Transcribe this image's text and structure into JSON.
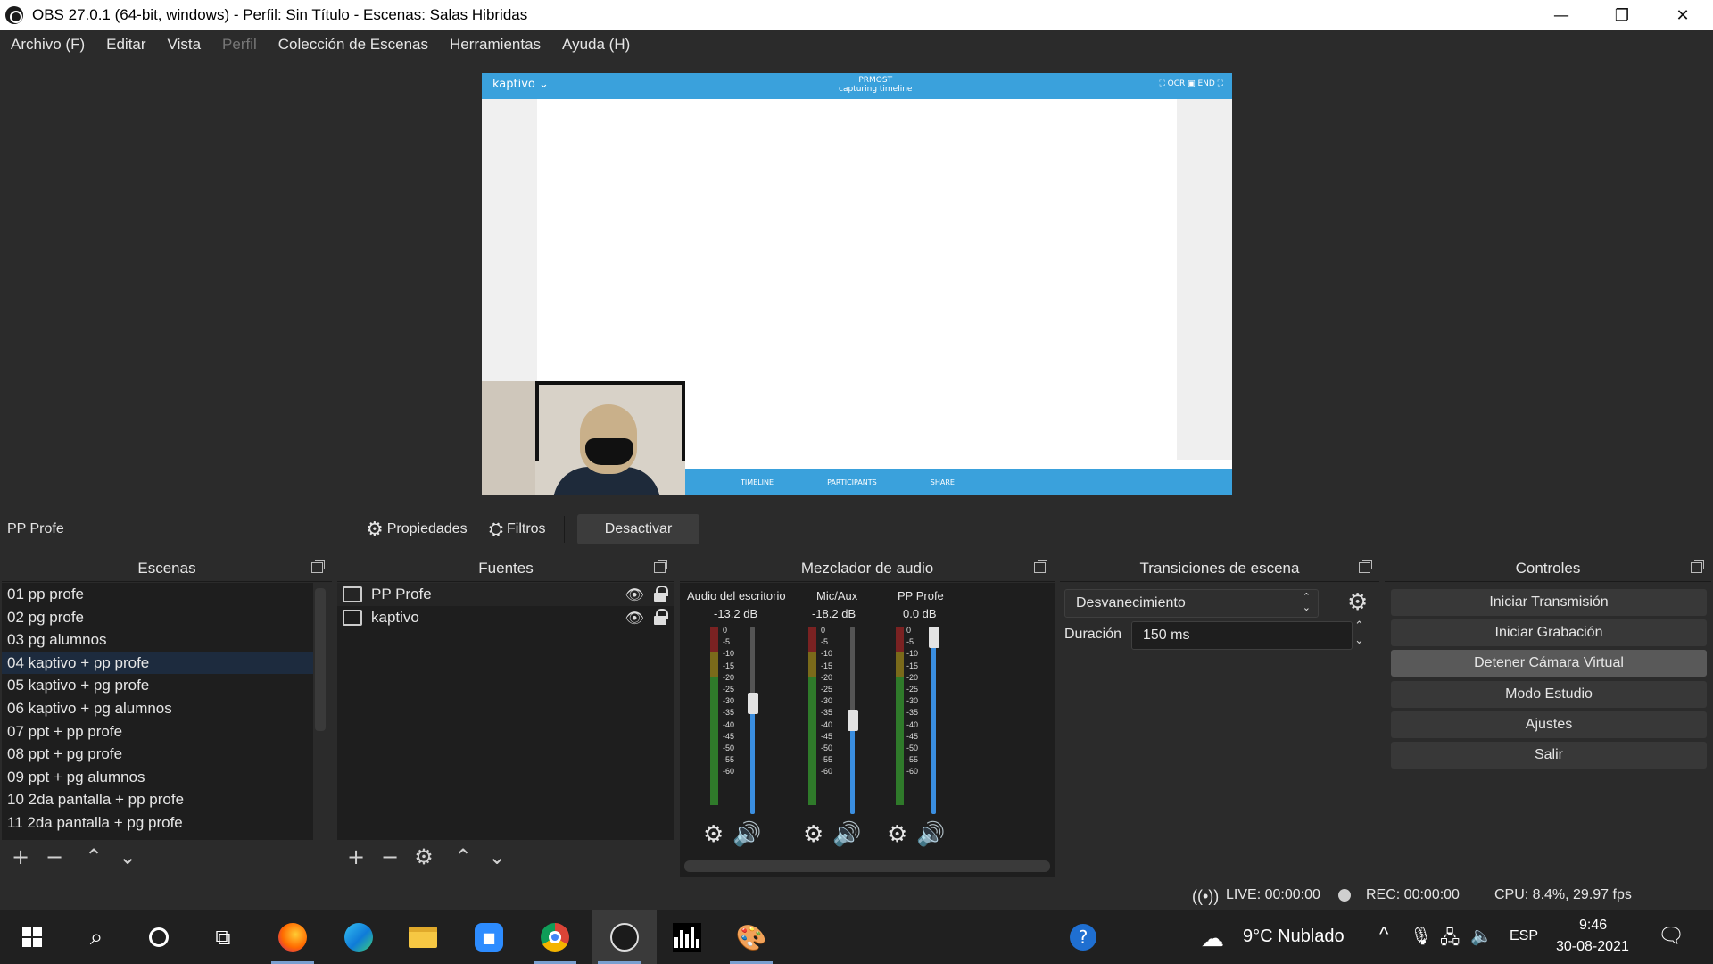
{
  "window": {
    "title": "OBS 27.0.1 (64-bit, windows) - Perfil: Sin Título - Escenas: Salas Hibridas",
    "minimize_glyph": "—",
    "maximize_glyph": "❐",
    "close_glyph": "✕"
  },
  "menu": [
    "Archivo (F)",
    "Editar",
    "Vista",
    "Perfil",
    "Colección de Escenas",
    "Herramientas",
    "Ayuda (H)"
  ],
  "preview": {
    "brand": "kaptivo ⌄",
    "center_title": "PRMOST",
    "center_subtitle": "capturing timeline",
    "right_tools": "⛶ OCR  ▣ END  ⛶",
    "bottom_tabs": [
      "TIMELINE",
      "PARTICIPANTS",
      "SHARE"
    ]
  },
  "source_bar": {
    "selected_source": "PP Profe",
    "properties_label": "Propiedades",
    "filters_label": "Filtros",
    "deactivate_label": "Desactivar"
  },
  "scenes": {
    "title": "Escenas",
    "items": [
      "01 pp profe",
      "02 pg profe",
      "03 pg alumnos",
      "04 kaptivo + pp profe",
      "05 kaptivo + pg profe",
      "06 kaptivo + pg alumnos",
      "07 ppt + pp profe",
      "08 ppt + pg profe",
      "09 ppt + pg alumnos",
      "10 2da pantalla + pp profe",
      "11 2da pantalla + pg profe"
    ],
    "selected_index": 3
  },
  "sources": {
    "title": "Fuentes",
    "items": [
      "PP Profe",
      "kaptivo"
    ]
  },
  "mixer": {
    "title": "Mezclador de audio",
    "channels": [
      {
        "name": "Audio del escritorio",
        "db": "-13.2 dB",
        "fader_level": 0.6
      },
      {
        "name": "Mic/Aux",
        "db": "-18.2 dB",
        "fader_level": 0.5
      },
      {
        "name": "PP Profe",
        "db": "0.0 dB",
        "fader_level": 1.0
      }
    ],
    "scale": [
      "0",
      "-5",
      "-10",
      "-15",
      "-20",
      "-25",
      "-30",
      "-35",
      "-40",
      "-45",
      "-50",
      "-55",
      "-60"
    ]
  },
  "transitions": {
    "title": "Transiciones de escena",
    "selected": "Desvanecimiento",
    "duration_label": "Duración",
    "duration_value": "150 ms"
  },
  "controls": {
    "title": "Controles",
    "buttons": [
      "Iniciar Transmisión",
      "Iniciar Grabación",
      "Detener Cámara Virtual",
      "Modo Estudio",
      "Ajustes",
      "Salir"
    ],
    "active_index": 2
  },
  "status": {
    "live": "LIVE: 00:00:00",
    "rec": "REC: 00:00:00",
    "cpu": "CPU: 8.4%, 29.97 fps"
  },
  "taskbar": {
    "weather": "9°C  Nublado",
    "language": "ESP",
    "time": "9:46",
    "date": "30-08-2021"
  },
  "colors": {
    "background": "#2b2b2b",
    "list_background": "#1e1e1e",
    "selection": "#1d2b3e",
    "accent_blue": "#3a8ee0",
    "kaptivo_blue": "#3aa1dc"
  }
}
